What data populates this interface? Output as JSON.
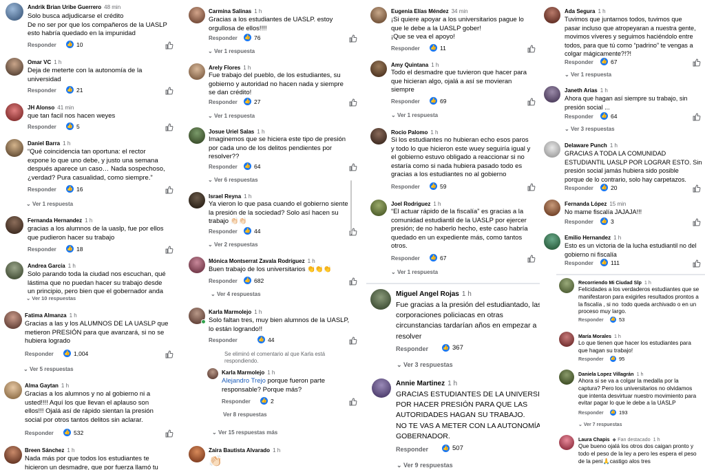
{
  "reply_label": "Responder",
  "colors": {
    "accent": "#1877f2",
    "mention": "#1b5bb7",
    "muted": "#65676b"
  },
  "col1": [
    {
      "name": "Andrik Brian Uribe Guerrero",
      "time": "48 min",
      "text": "Solo busca adjudicarse el crédito\nDe no ser por que los compañeros de la UASLP\nesto habría quedado en la impunidad",
      "reactions": "10"
    },
    {
      "name": "Omar VC",
      "time": "1 h",
      "text": "Deja de meterte con la autonomía de la\nuniversidad",
      "reactions": "21"
    },
    {
      "name": "JH Alonso",
      "time": "41 min",
      "text": "que tan facil nos hacen weyes",
      "reactions": "5"
    },
    {
      "name": "Daniel Barra",
      "time": "1 h",
      "text": "“Qué coincidencia tan oportuna: el rector\nexpone lo que uno debe, y justo una semana\ndespués aparece un caso… Nada sospechoso,\n¿verdad? Pura casualidad, como siempre.”",
      "reactions": "16",
      "view": "Ver 1 respuesta"
    },
    {
      "name": "Fernanda Hernandez",
      "time": "1 h",
      "text": "gracias a los alumnos de la uaslp, fue por ellos\nque pudieron hacer su trabajo",
      "reactions": "18"
    },
    {
      "name": "Andrea García",
      "time": "1 h",
      "text": "Solo parando toda la ciudad nos escuchan, qué\nlástima que no puedan hacer su trabajo desde\nun principio, pero bien que el gobernador anda",
      "view": "Ver 10 respuestas"
    },
    {
      "name": "Fatima Almanza",
      "time": "1 h",
      "text": "Gracias a las y los ALUMNOS DE LA UASLP que\nmetieron PRESIÓN para que avanzará, si no se\nhubiera logrado",
      "reactions": "1,004",
      "view": "Ver 5 respuestas"
    },
    {
      "name": "Alma Gaytan",
      "time": "1 h",
      "text": "Gracias a los alumnos y no al gobierno ni a\nusted!!!! Aquí los que llevan el aplauso son\nellos!!! Ojalá así de rápido sientan la presión\nsocial por otros tantos delitos sin aclarar.",
      "reactions": "532"
    },
    {
      "name": "Breen Sánchez",
      "time": "1 h",
      "text": "Nada más por que todos los estudiantes te\nhicieron un desmadre, que por fuerza llamó tu"
    }
  ],
  "col2": [
    {
      "name": "Carmina Salinas",
      "time": "1 h",
      "text": "Gracias a los estudiantes de UASLP. estoy\norgullosa de ellos!!!!",
      "reactions": "76",
      "view": "Ver 1 respuesta"
    },
    {
      "name": "Arely Flores",
      "time": "1 h",
      "text": "Fue trabajo del pueblo, de los estudiantes, su\ngobierno y autoridad no hacen nada y siempre\nse dan crédito!",
      "reactions": "27",
      "view": "Ver 1 respuesta"
    },
    {
      "name": "Josue Uriel Salas",
      "time": "1 h",
      "text": "Imaginemos que se hiciera este tipo de presión\npor cada uno de los delitos pendientes por\nresolver??",
      "reactions": "64",
      "view": "Ver 6 respuestas"
    },
    {
      "name": "Israel Reyna",
      "time": "1 h",
      "text": "Ya vieron lo que pasa cuando el gobierno siente\nla presión de la sociedad? Solo así hacen su\ntrabajo 👏🏻👏🏻",
      "reactions": "44",
      "view": "Ver 2 respuestas"
    },
    {
      "name": "Mónica Montserrat Zavala Rodríguez",
      "time": "1 h",
      "text": "Buen trabajo de los universitarios 👏👏👏",
      "reactions": "682",
      "view": "Ver 4 respuestas"
    },
    {
      "name": "Karla Marmolejo",
      "time": "1 h",
      "text": "Solo faltan tres, muy bien alumnos de la UASLP,\nlo están logrando!!",
      "reactions": "44"
    },
    {
      "deleted": "Se eliminó el comentario al que Karla está\nrespondiendo."
    },
    {
      "name": "Karla Marmolejo",
      "time": "1 h",
      "mention": "Alejandro Trejo",
      "text": " porque fueron parte\nresponsable? Porque más?",
      "reactions": "2",
      "view": "Ver 8 respuestas"
    },
    {
      "view": "Ver 15 respuestas más"
    },
    {
      "name": "Zaira Bautista Alvarado",
      "time": "1 h",
      "text": "👏🏻"
    }
  ],
  "col3": [
    {
      "name": "Eugenia Elías Méndez",
      "time": "34 min",
      "text": "¡Si quiere apoyar a los universitarios pague lo\nque le debe a la UASLP gober!\n¡Que se vea el apoyo!",
      "reactions": "11"
    },
    {
      "name": "Amy Quintana",
      "time": "1 h",
      "text": "Todo el desmadre que tuvieron que hacer para\nque hicieran algo, ojalá a así se movieran\nsiempre",
      "reactions": "69",
      "view": "Ver 1 respuesta"
    },
    {
      "name": "Rocio Palomo",
      "time": "1 h",
      "text": "Si los estudiantes no hubieran echo esos paros\ny todo lo que hicieron este wuey seguiría igual y\nel gobierno estuvo obligado a reaccionar si no\nestaría como si nada hubiera pasado todo es\ngracias a los estudiantes no al gobierno",
      "reactions": "59"
    },
    {
      "name": "Joel Rodriguez",
      "time": "1 h",
      "text": "“El actuar rápido de la fiscalía” es gracias a la\ncomunidad estudiantil de la UASLP por ejercer\npresión; de no haberlo hecho, este caso habría\nquedado en un expediente más, como tantos\notros.",
      "reactions": "67",
      "view": "Ver 1 respuesta"
    },
    {
      "name": "Miguel Angel Rojas",
      "time": "1 h",
      "text": "Fue gracias a la presión del estudiantado, las\ncorporaciones policiacas en otras\ncircunstancias tardarían años en empezar a\nresolver",
      "reactions": "367",
      "view": "Ver 3 respuestas"
    },
    {
      "name": "Annie Martinez",
      "time": "1 h",
      "text": "GRACIAS ESTUDIANTES DE LA UNIVERSIDAD\nPOR HACER PRESIÓN PARA QUE LAS\nAUTORIDADES HAGAN SU TRABAJO.\nNO TE VAS A METER CON LA AUTONOMÍA,\nGOBERNADOR.",
      "reactions": "507",
      "view": "Ver 9 respuestas"
    }
  ],
  "col4": [
    {
      "name": "Ada Segura",
      "time": "1 h",
      "text": "Tuvimos que juntarnos todos, tuvimos que\npasar incluso que atropeyaran a nuestra gente,\nmovimos víveres y seguimos haciéndolo entre\ntodos, para que tú como “padrino” te vengas a\ncolgar mágicamente?!?!",
      "reactions": "67",
      "view": "Ver 1 respuesta"
    },
    {
      "name": "Janeth Arias",
      "time": "1 h",
      "text": "Ahora que hagan así siempre su trabajo, sin\npresión social ...",
      "reactions": "64",
      "view": "Ver 3 respuestas"
    },
    {
      "name": "Delaware Punch",
      "time": "1 h",
      "text": "GRACIAS A TODA LA COMUNIDAD\nESTUDIANTIL UASLP POR LOGRAR ESTO. Sin\npresión social jamás hubiera sido posible\nporque de lo contrario, solo hay carpetazos.",
      "reactions": "20"
    },
    {
      "name": "Fernanda López",
      "time": "15 min",
      "text": "No mame fiscalía JAJAJA!!!",
      "reactions": "3"
    },
    {
      "name": "Emilio Hernandez",
      "time": "1 h",
      "text": "Esto es un victoria de la lucha estudiantil no del\ngobierno ni fiscalía",
      "reactions": "111"
    },
    {
      "name": "Recorriendo Mi Ciudad Slp",
      "time": "1 h",
      "text": "Felicidades a los verdaderos estudiantes que se\nmanifestaron para exigirles resultados prontos a\nla fiscalía , si no  todo queda archivado o en un\nproceso muy largo.",
      "reactions": "53"
    },
    {
      "name": "María Morales",
      "time": "1 h",
      "text": "Lo que tienen que hacer los estudiantes para\nque hagan su trabajo!",
      "reactions": "95"
    },
    {
      "name": "Daniela Lopez Villagrán",
      "time": "1 h",
      "text": "Ahora si se va a colgar la medalla por la\ncaptura? Pero los universitarios no olvidamos\nque intenta desvirtuar nuestro movimiento para\nevitar pagar lo que le debe a la UASLP",
      "reactions": "193",
      "view": "Ver 7 respuestas"
    },
    {
      "name": "Laura Chapis",
      "badge": "Fan destacado",
      "time": "1 h",
      "text": "Que bueno ojalá los otros dos caigan pronto y\ntodo el peso de la ley a pero les espera el peso\nde la peni🙏castigo alos tres"
    }
  ]
}
